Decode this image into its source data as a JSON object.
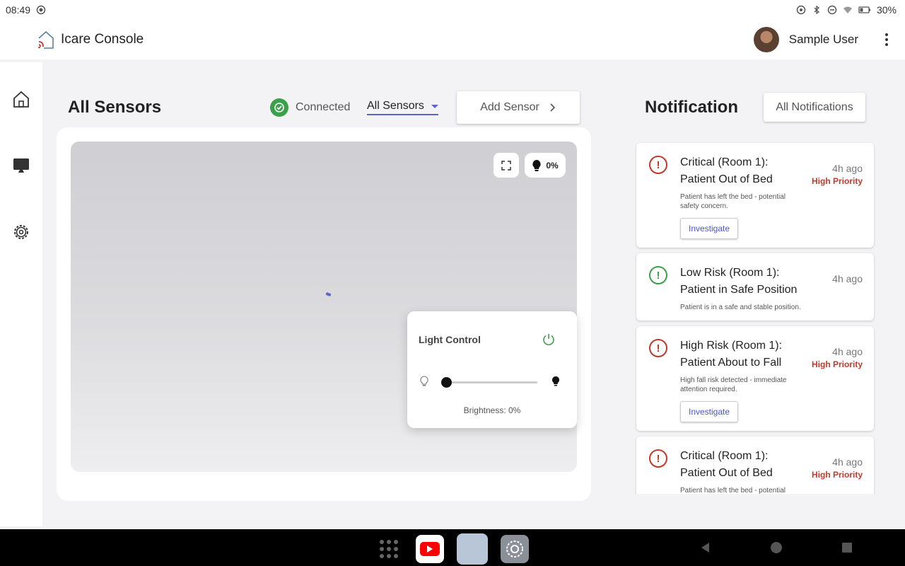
{
  "status_bar": {
    "time": "08:49",
    "battery": "30%"
  },
  "app": {
    "title": "Icare Console"
  },
  "user": {
    "name": "Sample User"
  },
  "sidebar": {
    "items": [
      {
        "id": "home",
        "icon": "home-icon"
      },
      {
        "id": "monitor",
        "icon": "monitor-icon"
      },
      {
        "id": "settings",
        "icon": "settings-gear-icon"
      }
    ]
  },
  "sensors": {
    "title": "All Sensors",
    "connection_status": "Connected",
    "filter_value": "All Sensors",
    "add_button": "Add Sensor",
    "light_level_badge": "0%"
  },
  "light_control": {
    "title": "Light Control",
    "brightness_label": "Brightness: 0%",
    "brightness_value": 0,
    "power_color": "#3aa04a"
  },
  "notifications": {
    "title": "Notification",
    "all_button": "All Notifications",
    "items": [
      {
        "title": "Critical (Room 1): Patient Out of Bed",
        "time": "4h ago",
        "priority": "High Priority",
        "desc": "Patient has left the bed - potential safety concern.",
        "action": "Investigate",
        "level": "critical"
      },
      {
        "title": "Low Risk (Room 1): Patient in Safe Position",
        "time": "4h ago",
        "priority": "",
        "desc": "Patient is in a safe and stable position.",
        "action": "",
        "level": "low"
      },
      {
        "title": "High Risk (Room 1): Patient About to Fall",
        "time": "4h ago",
        "priority": "High Priority",
        "desc": "High fall risk detected - immediate attention required.",
        "action": "Investigate",
        "level": "high"
      },
      {
        "title": "Critical (Room 1): Patient Out of Bed",
        "time": "4h ago",
        "priority": "High Priority",
        "desc": "Patient has left the bed - potential safety concern.",
        "action": "",
        "level": "critical"
      }
    ]
  },
  "colors": {
    "accent": "#5b64c8",
    "danger": "#c0392b",
    "success": "#3aa04a"
  }
}
